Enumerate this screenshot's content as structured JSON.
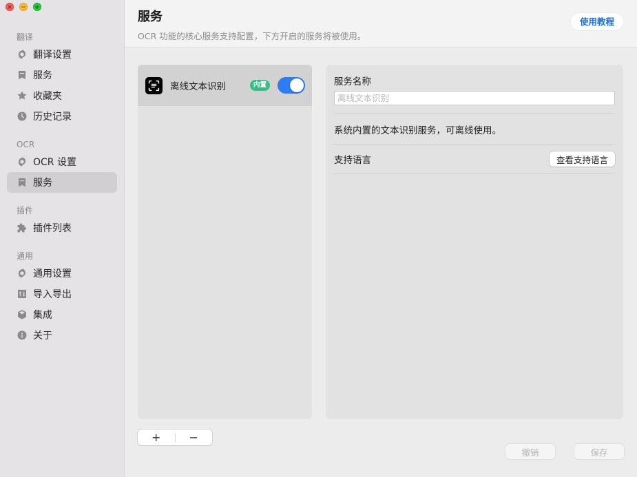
{
  "window": {
    "traffic_lights": {
      "close": "×",
      "minimize": "−",
      "maximize": "+"
    }
  },
  "sidebar": {
    "sections": [
      {
        "title": "翻译",
        "items": [
          {
            "label": "翻译设置",
            "icon": "gear-icon"
          },
          {
            "label": "服务",
            "icon": "bookmark-icon"
          },
          {
            "label": "收藏夹",
            "icon": "star-icon"
          },
          {
            "label": "历史记录",
            "icon": "clock-icon"
          }
        ]
      },
      {
        "title": "OCR",
        "items": [
          {
            "label": "OCR 设置",
            "icon": "gear-icon"
          },
          {
            "label": "服务",
            "icon": "bookmark-icon",
            "active": true
          }
        ]
      },
      {
        "title": "插件",
        "items": [
          {
            "label": "插件列表",
            "icon": "puzzle-icon"
          }
        ]
      },
      {
        "title": "通用",
        "items": [
          {
            "label": "通用设置",
            "icon": "gear-icon"
          },
          {
            "label": "导入导出",
            "icon": "import-export-icon"
          },
          {
            "label": "集成",
            "icon": "cube-icon"
          },
          {
            "label": "关于",
            "icon": "info-icon"
          }
        ]
      }
    ]
  },
  "header": {
    "title": "服务",
    "subtitle": "OCR 功能的核心服务支持配置，下方开启的服务将被使用。",
    "tutorial_label": "使用教程"
  },
  "service_list": {
    "items": [
      {
        "name": "离线文本识别",
        "badge": "内置",
        "enabled": true
      }
    ],
    "add_label": "+",
    "remove_label": "−"
  },
  "detail": {
    "name_label": "服务名称",
    "name_placeholder": "离线文本识别",
    "name_value": "",
    "description": "系统内置的文本识别服务，可离线使用。",
    "languages_label": "支持语言",
    "view_languages_label": "查看支持语言"
  },
  "footer": {
    "cancel_label": "撤销",
    "save_label": "保存"
  },
  "colors": {
    "accent": "#2e7cf6",
    "badge": "#32bf87",
    "link": "#1f6fe0"
  }
}
